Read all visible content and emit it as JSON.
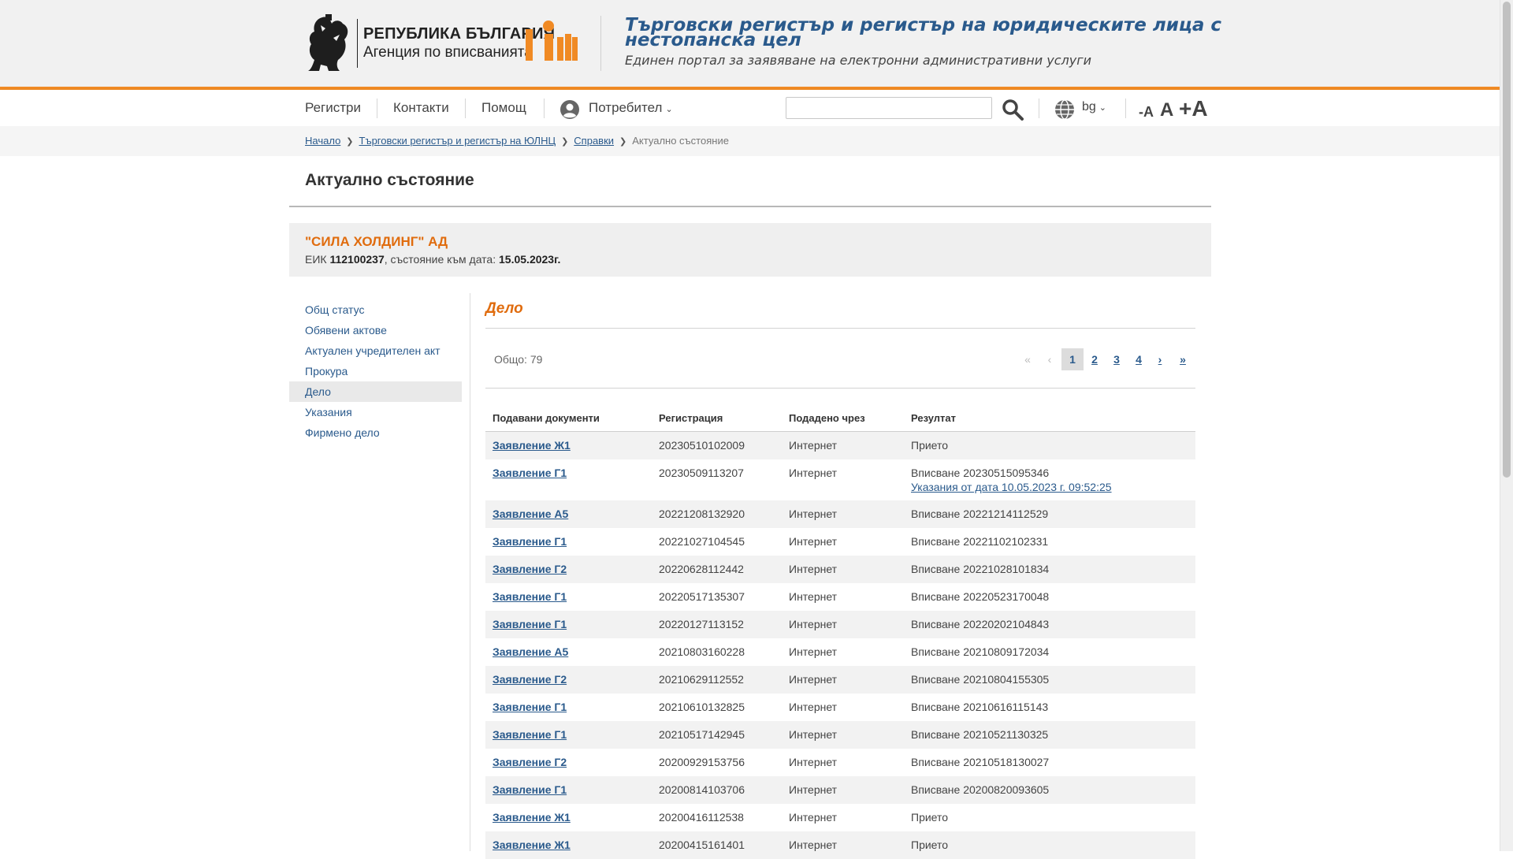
{
  "header": {
    "logo_line1": "РЕПУБЛИКА БЪЛГАРИЯ",
    "logo_line2": "Агенция по вписванията",
    "site_title": "Търговски регистър и регистър на юридическите лица с нестопанска цел",
    "site_subtitle": "Единен портал за заявяване на електронни административни услуги"
  },
  "nav": {
    "registers": "Регистри",
    "contacts": "Контакти",
    "help": "Помощ",
    "user": "Потребител",
    "search_value": "",
    "lang": "bg",
    "font_dec": "-A",
    "font_inc": "A",
    "font_max": "+A"
  },
  "breadcrumb": {
    "home": "Начало",
    "register": "Търговски регистър и регистър на ЮЛНЦ",
    "references": "Справки",
    "current": "Актуално състояние"
  },
  "page_title": "Актуално състояние",
  "company": {
    "name": "\"СИЛА ХОЛДИНГ\" АД",
    "eik_label": "ЕИК",
    "eik": "112100237",
    "state_label": ", състояние към дата:",
    "date": "15.05.2023г."
  },
  "sidebar": {
    "items": [
      "Общ статус",
      "Обявени актове",
      "Актуален учредителен акт",
      "Прокура",
      "Дело",
      "Указания",
      "Фирмено дело"
    ],
    "active_index": 4
  },
  "section": {
    "title": "Дело",
    "total": "Общо: 79"
  },
  "pager": {
    "first": "«",
    "prev": "‹",
    "pages": [
      "1",
      "2",
      "3",
      "4"
    ],
    "active": "1",
    "next": "›",
    "last": "»"
  },
  "table": {
    "headers": [
      "Подавани документи",
      "Регистрация",
      "Подадено чрез",
      "Резултат"
    ],
    "rows": [
      {
        "doc": "Заявление Ж1",
        "reg": "20230510102009",
        "via": "Интернет",
        "result": "Прието",
        "link": ""
      },
      {
        "doc": "Заявление Г1",
        "reg": "20230509113207",
        "via": "Интернет",
        "result": "Вписване 20230515095346",
        "link": "Указания от дата 10.05.2023 г. 09:52:25"
      },
      {
        "doc": "Заявление А5",
        "reg": "20221208132920",
        "via": "Интернет",
        "result": "Вписване 20221214112529",
        "link": ""
      },
      {
        "doc": "Заявление Г1",
        "reg": "20221027104545",
        "via": "Интернет",
        "result": "Вписване 20221102102331",
        "link": ""
      },
      {
        "doc": "Заявление Г2",
        "reg": "20220628112442",
        "via": "Интернет",
        "result": "Вписване 20221028101834",
        "link": ""
      },
      {
        "doc": "Заявление Г1",
        "reg": "20220517135307",
        "via": "Интернет",
        "result": "Вписване 20220523170048",
        "link": ""
      },
      {
        "doc": "Заявление Г1",
        "reg": "20220127113152",
        "via": "Интернет",
        "result": "Вписване 20220202104843",
        "link": ""
      },
      {
        "doc": "Заявление А5",
        "reg": "20210803160228",
        "via": "Интернет",
        "result": "Вписване 20210809172034",
        "link": ""
      },
      {
        "doc": "Заявление Г2",
        "reg": "20210629112552",
        "via": "Интернет",
        "result": "Вписване 20210804155305",
        "link": ""
      },
      {
        "doc": "Заявление Г1",
        "reg": "20210610132825",
        "via": "Интернет",
        "result": "Вписване 20210616115143",
        "link": ""
      },
      {
        "doc": "Заявление Г1",
        "reg": "20210517142945",
        "via": "Интернет",
        "result": "Вписване 20210521130325",
        "link": ""
      },
      {
        "doc": "Заявление Г2",
        "reg": "20200929153756",
        "via": "Интернет",
        "result": "Вписване 20210518130027",
        "link": ""
      },
      {
        "doc": "Заявление Г1",
        "reg": "20200814103706",
        "via": "Интернет",
        "result": "Вписване 20200820093605",
        "link": ""
      },
      {
        "doc": "Заявление Ж1",
        "reg": "20200416112538",
        "via": "Интернет",
        "result": "Прието",
        "link": ""
      },
      {
        "doc": "Заявление Ж1",
        "reg": "20200415161401",
        "via": "Интернет",
        "result": "Прието",
        "link": ""
      }
    ]
  },
  "colors": {
    "accent_orange": "#f08a24",
    "title_blue": "#2a5a8c",
    "company_orange": "#e06c0e"
  },
  "icons": {
    "lion": "coat-of-arms-lion-icon",
    "agency_logo": "registry-agency-logo-icon",
    "user": "user-circle-icon",
    "search": "search-icon",
    "globe": "globe-icon"
  }
}
